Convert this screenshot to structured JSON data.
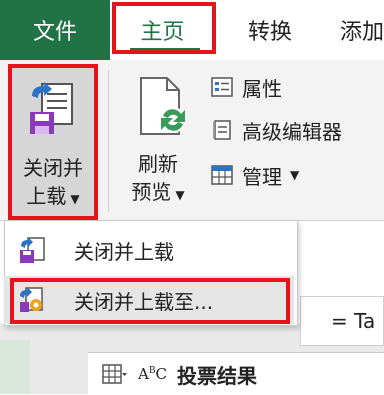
{
  "tabs": {
    "file": "文件",
    "home": "主页",
    "convert": "转换",
    "add": "添加"
  },
  "ribbon": {
    "close_load_line1": "关闭并",
    "close_load_line2": "上载",
    "refresh_line1": "刷新",
    "refresh_line2": "预览",
    "properties": "属性",
    "advanced_editor": "高级编辑器",
    "manage": "管理"
  },
  "dropdown": {
    "items": [
      {
        "label": "关闭并上载"
      },
      {
        "label": "关闭并上载至..."
      }
    ]
  },
  "formula": {
    "value": "= Ta"
  },
  "table": {
    "column_header": "投票结果"
  },
  "colors": {
    "file_tab_bg": "#217346",
    "highlight_red": "#e4141c",
    "ribbon_bg": "#f3f3f3"
  },
  "icons": {
    "close_load": "close-and-load-icon",
    "refresh": "refresh-preview-icon",
    "properties": "properties-icon",
    "advanced_editor": "advanced-editor-icon",
    "manage": "manage-icon",
    "load": "load-icon",
    "load_to": "load-to-icon",
    "table": "table-icon",
    "type": "abc-type-icon"
  }
}
